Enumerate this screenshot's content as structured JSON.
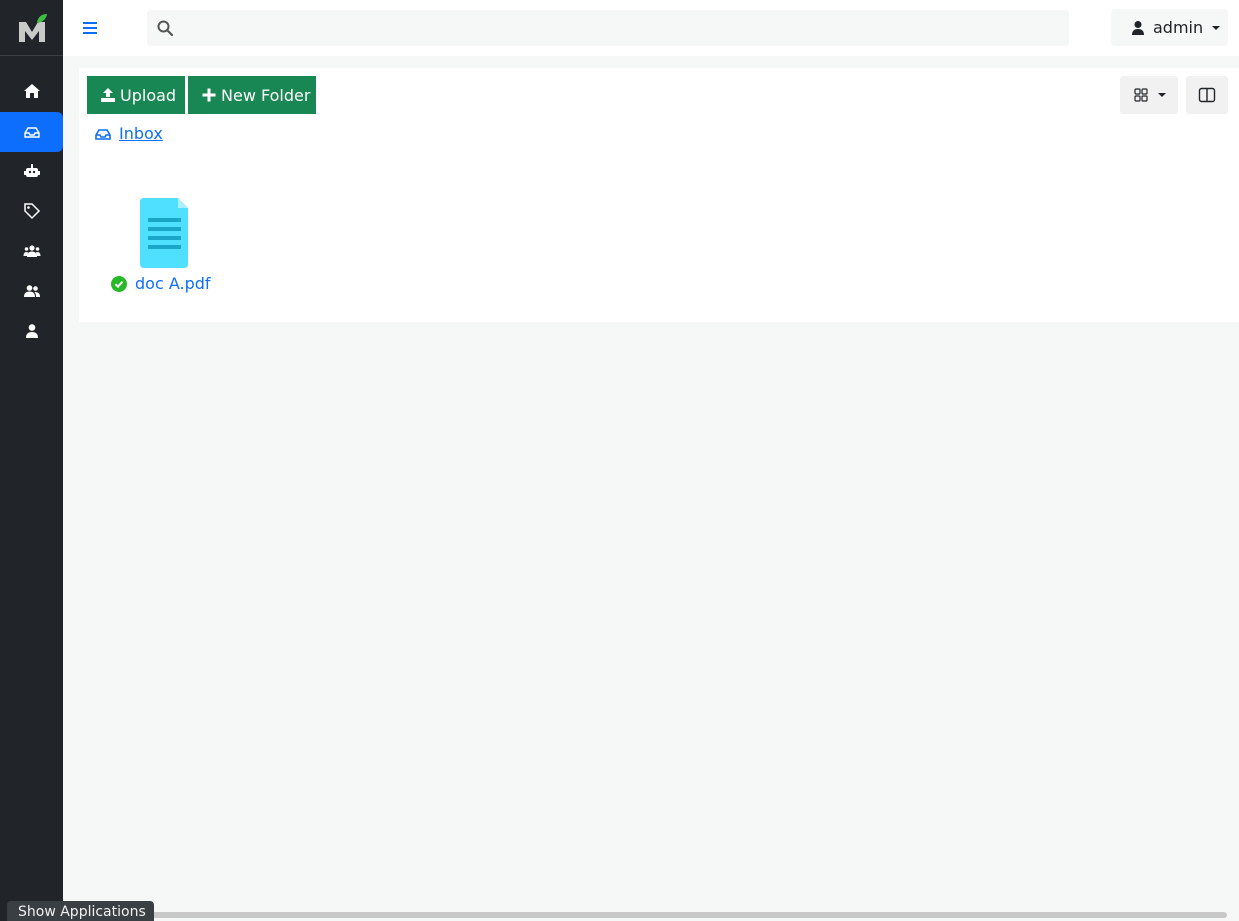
{
  "header": {
    "menu_icon": "hamburger-icon",
    "search": {
      "icon": "search-icon",
      "placeholder": "",
      "value": ""
    },
    "user": {
      "icon": "user-icon",
      "name": "admin"
    }
  },
  "sidebar": {
    "logo": "app-logo",
    "items": [
      {
        "icon": "home-icon",
        "active": false
      },
      {
        "icon": "inbox-icon",
        "active": true
      },
      {
        "icon": "robot-icon",
        "active": false
      },
      {
        "icon": "tags-icon",
        "active": false
      },
      {
        "icon": "groups-icon",
        "active": false
      },
      {
        "icon": "users-icon",
        "active": false
      },
      {
        "icon": "user-icon",
        "active": false
      }
    ]
  },
  "toolbar": {
    "upload_label": "Upload",
    "new_folder_label": "New Folder",
    "view_toggle_icon": "grid-icon",
    "panel_toggle_icon": "split-panel-icon"
  },
  "breadcrumb": {
    "icon": "inbox-icon",
    "label": "Inbox"
  },
  "files": [
    {
      "name": "doc A.pdf",
      "status": "ok",
      "icon": "document-icon"
    }
  ],
  "footer": {
    "show_apps_label": "Show Applications"
  },
  "colors": {
    "sidebar_bg": "#212529",
    "active": "#0d6efd",
    "green": "#198754",
    "link": "#0d6efd",
    "doc_icon": "#4fe0ff"
  }
}
